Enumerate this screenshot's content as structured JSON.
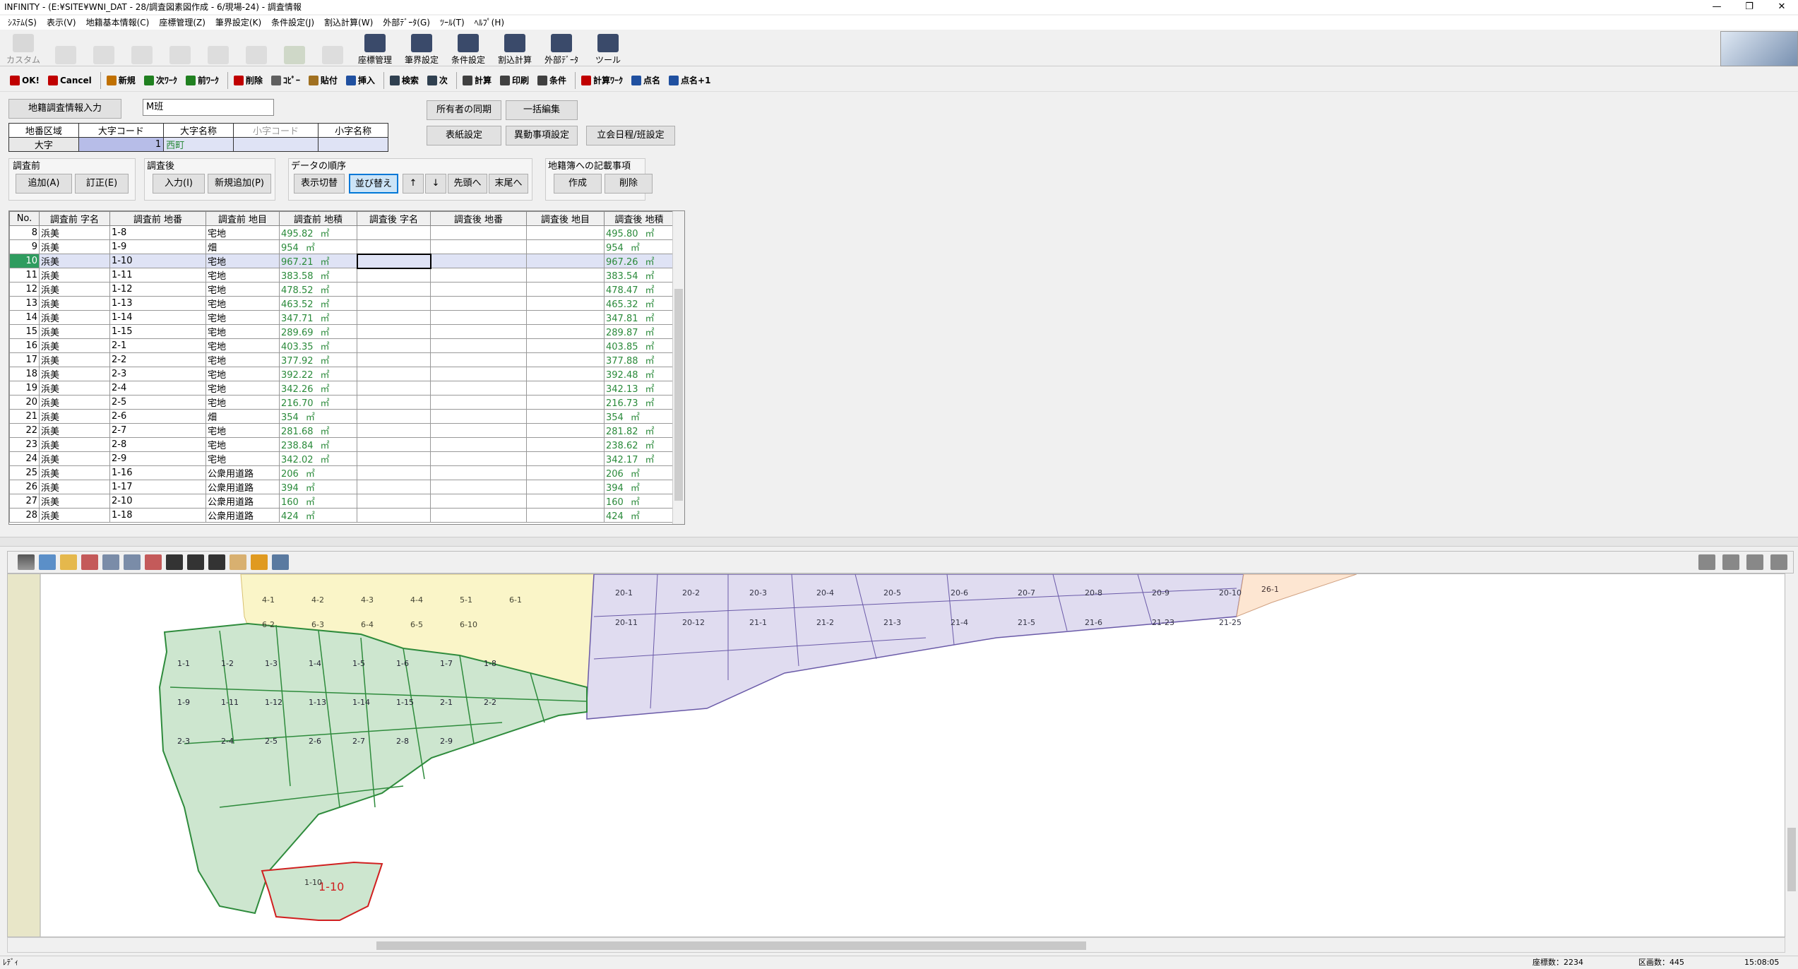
{
  "window": {
    "title": "INFINITY - (E:¥SITE¥WNI_DAT - 28/調査図素図作成 - 6/現場-24) - 調査情報",
    "minimize": "—",
    "restore": "❐",
    "close": "✕"
  },
  "menu": [
    "ｼｽﾃﾑ(S)",
    "表示(V)",
    "地籍基本情報(C)",
    "座標管理(Z)",
    "筆界設定(K)",
    "条件設定(J)",
    "割込計算(W)",
    "外部ﾃﾞｰﾀ(G)",
    "ﾂｰﾙ(T)",
    "ﾍﾙﾌﾟ(H)"
  ],
  "toolbar1": {
    "custom": "カスタム",
    "items": [
      {
        "label": "座標管理",
        "icon": "xyz-icon"
      },
      {
        "label": "筆界設定",
        "icon": "boundary-icon"
      },
      {
        "label": "条件設定",
        "icon": "condition-icon"
      },
      {
        "label": "割込計算",
        "icon": "calc-icon"
      },
      {
        "label": "外部ﾃﾞｰﾀ",
        "icon": "sim-txt-icon"
      },
      {
        "label": "ツール",
        "icon": "tool-icon"
      }
    ]
  },
  "toolbar2": [
    {
      "label": "OK!",
      "icon": "ok-icon",
      "color": "#c00000"
    },
    {
      "label": "Cancel",
      "icon": "cancel-icon",
      "color": "#c00000"
    },
    {
      "label": "新規",
      "icon": "new-icon",
      "color": "#c07000"
    },
    {
      "label": "次ﾜｰｸ",
      "icon": "next-work-icon",
      "color": "#208020"
    },
    {
      "label": "前ﾜｰｸ",
      "icon": "prev-work-icon",
      "color": "#208020"
    },
    {
      "label": "削除",
      "icon": "scissors-icon",
      "color": "#c00000"
    },
    {
      "label": "ｺﾋﾟｰ",
      "icon": "copy-icon",
      "color": "#606060"
    },
    {
      "label": "貼付",
      "icon": "paste-icon",
      "color": "#a07020"
    },
    {
      "label": "挿入",
      "icon": "insert-icon",
      "color": "#2050a0"
    },
    {
      "label": "検索",
      "icon": "search-icon",
      "color": "#304050"
    },
    {
      "label": "次",
      "icon": "search-next-icon",
      "color": "#304050"
    },
    {
      "label": "計算",
      "icon": "calculator-icon",
      "color": "#404040"
    },
    {
      "label": "印刷",
      "icon": "print-icon",
      "color": "#404040"
    },
    {
      "label": "条件",
      "icon": "condition-icon",
      "color": "#404040"
    },
    {
      "label": "計算ﾜｰｸ",
      "icon": "calc-work-icon",
      "color": "#c00000"
    },
    {
      "label": "点名",
      "icon": "point-name-icon",
      "color": "#2050a0"
    },
    {
      "label": "点名+1",
      "icon": "point-name-plus-icon",
      "color": "#2050a0"
    }
  ],
  "form": {
    "survey_button": "地籍調査情報入力",
    "team_value": "M班",
    "owner_sync": "所有者の同期",
    "bulk_edit": "一括編集",
    "cover_settings": "表紙設定",
    "change_settings": "異動事項設定",
    "meeting_schedule": "立会日程/班設定",
    "area_headers": [
      "地番区域",
      "大字コード",
      "大字名称",
      "小字コード",
      "小字名称"
    ],
    "area_row": [
      "大字",
      "1",
      "西町",
      "",
      ""
    ],
    "before_label": "調査前",
    "after_label": "調査後",
    "order_label": "データの順序",
    "registry_label": "地籍簿への記載事項",
    "add_btn": "追加(A)",
    "fix_btn": "訂正(E)",
    "input_btn": "入力(I)",
    "new_add_btn": "新規追加(P)",
    "display_switch": "表示切替",
    "sort_btn": "並び替え",
    "up_btn": "↑",
    "down_btn": "↓",
    "first_btn": "先頭へ",
    "last_btn": "末尾へ",
    "create_btn": "作成",
    "delete_btn": "削除"
  },
  "grid": {
    "headers": [
      "No.",
      "調査前 字名",
      "調査前 地番",
      "調査前 地目",
      "調査前 地積",
      "調査後 字名",
      "調査後 地番",
      "調査後 地目",
      "調査後 地積"
    ],
    "unit": "㎡",
    "rows": [
      [
        "8",
        "浜美",
        "1-8",
        "宅地",
        "495.82",
        "495.80"
      ],
      [
        "9",
        "浜美",
        "1-9",
        "畑",
        "954",
        "954"
      ],
      [
        "10",
        "浜美",
        "1-10",
        "宅地",
        "967.21",
        "967.26"
      ],
      [
        "11",
        "浜美",
        "1-11",
        "宅地",
        "383.58",
        "383.54"
      ],
      [
        "12",
        "浜美",
        "1-12",
        "宅地",
        "478.52",
        "478.47"
      ],
      [
        "13",
        "浜美",
        "1-13",
        "宅地",
        "463.52",
        "465.32"
      ],
      [
        "14",
        "浜美",
        "1-14",
        "宅地",
        "347.71",
        "347.81"
      ],
      [
        "15",
        "浜美",
        "1-15",
        "宅地",
        "289.69",
        "289.87"
      ],
      [
        "16",
        "浜美",
        "2-1",
        "宅地",
        "403.35",
        "403.85"
      ],
      [
        "17",
        "浜美",
        "2-2",
        "宅地",
        "377.92",
        "377.88"
      ],
      [
        "18",
        "浜美",
        "2-3",
        "宅地",
        "392.22",
        "392.48"
      ],
      [
        "19",
        "浜美",
        "2-4",
        "宅地",
        "342.26",
        "342.13"
      ],
      [
        "20",
        "浜美",
        "2-5",
        "宅地",
        "216.70",
        "216.73"
      ],
      [
        "21",
        "浜美",
        "2-6",
        "畑",
        "354",
        "354"
      ],
      [
        "22",
        "浜美",
        "2-7",
        "宅地",
        "281.68",
        "281.82"
      ],
      [
        "23",
        "浜美",
        "2-8",
        "宅地",
        "238.84",
        "238.62"
      ],
      [
        "24",
        "浜美",
        "2-9",
        "宅地",
        "342.02",
        "342.17"
      ],
      [
        "25",
        "浜美",
        "1-16",
        "公衆用道路",
        "206",
        "206"
      ],
      [
        "26",
        "浜美",
        "1-17",
        "公衆用道路",
        "394",
        "394"
      ],
      [
        "27",
        "浜美",
        "2-10",
        "公衆用道路",
        "160",
        "160"
      ],
      [
        "28",
        "浜美",
        "1-18",
        "公衆用道路",
        "424",
        "424"
      ]
    ],
    "selected_row": "10"
  },
  "map": {
    "green_parcels": [
      "1-1",
      "1-2",
      "1-3",
      "1-4",
      "1-5",
      "1-6",
      "1-7",
      "1-8",
      "1-9",
      "1-11",
      "1-12",
      "1-13",
      "1-14",
      "1-15",
      "2-1",
      "2-2",
      "2-3",
      "2-4",
      "2-5",
      "2-6",
      "2-7",
      "2-8",
      "2-9"
    ],
    "yellow_parcels": [
      "4-1",
      "4-2",
      "4-3",
      "4-4",
      "5-1",
      "6-1",
      "6-2",
      "6-3",
      "6-4",
      "6-5",
      "6-10"
    ],
    "purple_parcels": [
      "20-1",
      "20-2",
      "20-3",
      "20-4",
      "20-5",
      "20-6",
      "20-7",
      "20-8",
      "20-9",
      "20-10",
      "20-11",
      "20-12",
      "21-1",
      "21-2",
      "21-3",
      "21-4",
      "21-5",
      "21-6",
      "21-23",
      "21-25"
    ],
    "orange_parcels": [
      "26-1"
    ],
    "selected_label": "1-10",
    "selected_sublabel": "1-10"
  },
  "status": {
    "left": "ﾚﾃﾞｨ",
    "points": "座標数：2234",
    "sections": "区画数：445",
    "time": "15:08:05"
  }
}
